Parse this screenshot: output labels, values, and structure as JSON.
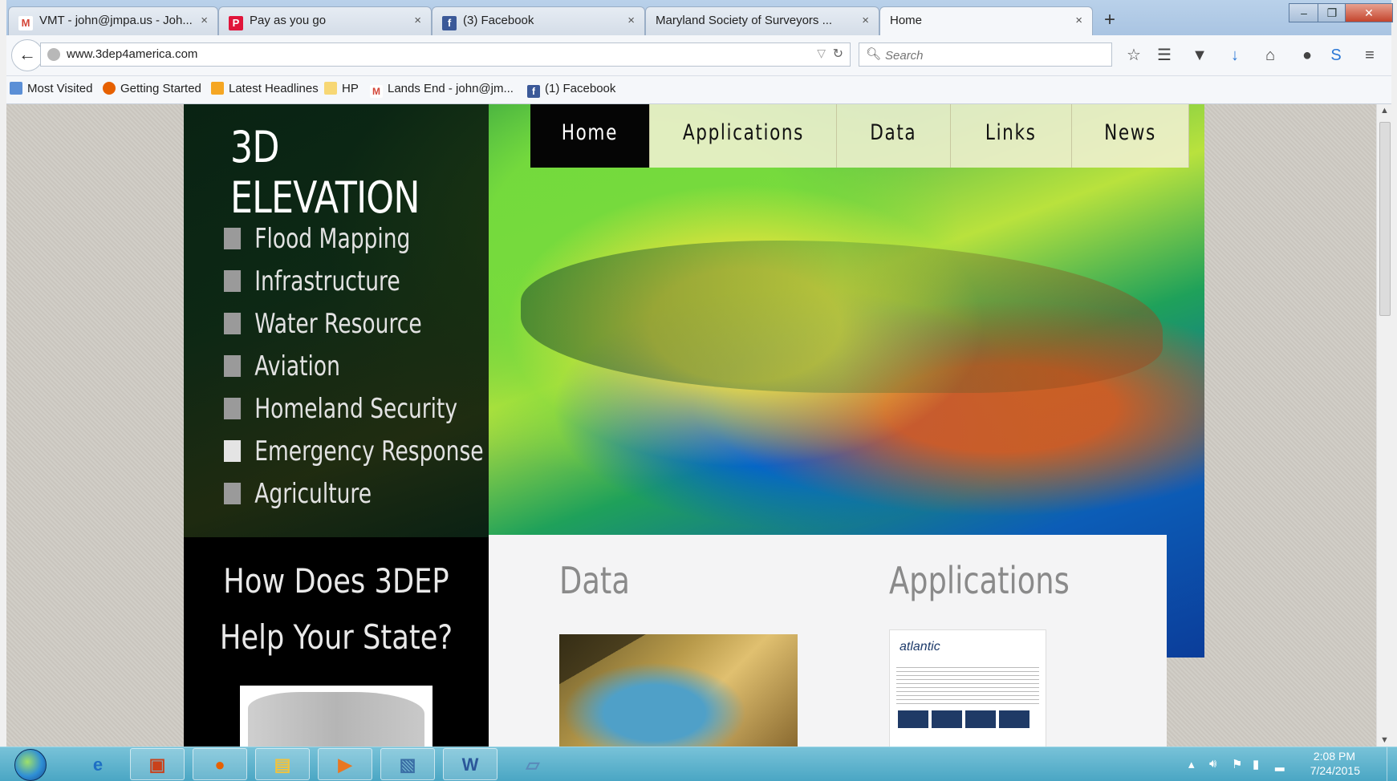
{
  "browser": {
    "tabs": [
      {
        "favicon": "gmail-icon",
        "favicon_text": "M",
        "favicon_color": "#d44638",
        "title": "VMT - john@jmpa.us - Joh...",
        "close": "×"
      },
      {
        "favicon": "pandora-icon",
        "favicon_text": "P",
        "favicon_color": "#e0143a",
        "title": "Pay as you go",
        "close": "×"
      },
      {
        "favicon": "facebook-icon",
        "favicon_text": "f",
        "favicon_color": "#3b5998",
        "title": "(3) Facebook",
        "close": "×"
      },
      {
        "favicon": "",
        "favicon_text": "",
        "favicon_color": "",
        "title": "Maryland Society of Surveyors ...",
        "close": "×"
      },
      {
        "favicon": "",
        "favicon_text": "",
        "favicon_color": "",
        "title": "Home",
        "close": "×",
        "active": true
      }
    ],
    "new_tab": "+",
    "url": "www.3dep4america.com",
    "search_placeholder": "Search",
    "bookmarks": [
      {
        "icon": "most-visited-icon",
        "label": "Most Visited"
      },
      {
        "icon": "firefox-icon",
        "label": "Getting Started"
      },
      {
        "icon": "rss-icon",
        "label": "Latest Headlines"
      },
      {
        "icon": "folder-icon",
        "label": "HP"
      },
      {
        "icon": "gmail-icon",
        "label": "Lands End - john@jm..."
      },
      {
        "icon": "facebook-icon",
        "label": "(1) Facebook"
      }
    ]
  },
  "site": {
    "title": "3D ELEVATION",
    "nav": [
      "Home",
      "Applications",
      "Data",
      "Links",
      "News"
    ],
    "active_nav": "Home",
    "applications": [
      "Flood Mapping",
      "Infrastructure",
      "Water Resource",
      "Aviation",
      "Homeland Security",
      "Emergency Response",
      "Agriculture"
    ],
    "help_title_line1": "How Does 3DEP",
    "help_title_line2": "Help Your State?",
    "data_heading": "Data",
    "applications_heading": "Applications",
    "atlantic_logo": "atlantic"
  },
  "taskbar": {
    "time": "2:08 PM",
    "date": "7/24/2015",
    "pinned": [
      "internet-explorer-icon",
      "presentation-icon",
      "firefox-icon",
      "file-explorer-icon",
      "media-player-icon",
      "photo-viewer-icon",
      "word-icon",
      "notes-icon"
    ]
  },
  "colors": {
    "accent_nav_active": "#050505",
    "nav_bg": "#f0f0d2",
    "sidebar_bg": "#05100a"
  }
}
